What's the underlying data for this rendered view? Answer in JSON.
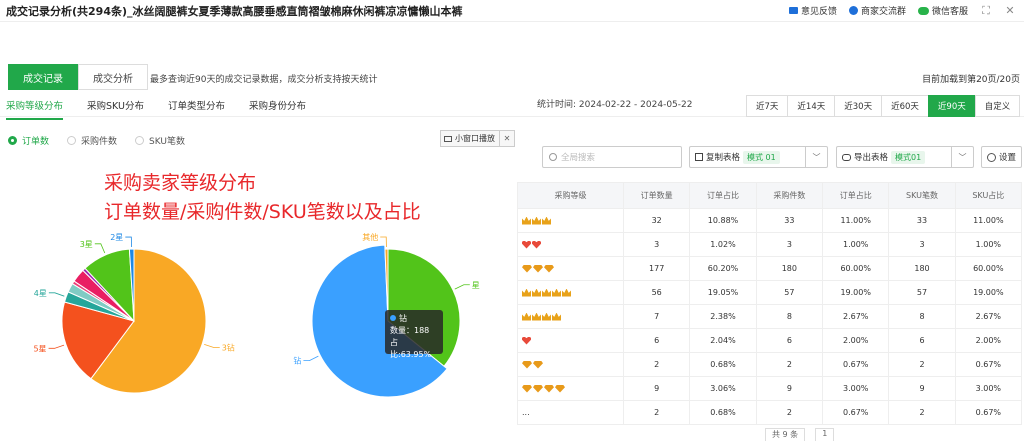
{
  "window": {
    "title": "成交记录分析(共294条)_冰丝阔腿裤女夏季薄款高腰垂感直筒褶皱棉麻休闲裤凉凉慵懒山本裤",
    "feedback": "意见反馈",
    "merchant_group": "商家交流群",
    "wechat_service": "微信客服"
  },
  "main_tabs": [
    {
      "label": "成交记录",
      "active": true
    },
    {
      "label": "成交分析",
      "active": false
    }
  ],
  "main_desc": "最多查询近90天的成交记录数据，成交分析支持按天统计",
  "loaded_text": "目前加载到第20页/20页",
  "sub_tabs": [
    {
      "label": "采购等级分布",
      "active": true
    },
    {
      "label": "采购SKU分布",
      "active": false
    },
    {
      "label": "订单类型分布",
      "active": false
    },
    {
      "label": "采购身份分布",
      "active": false
    }
  ],
  "stat_time": "统计时间: 2024-02-22 - 2024-05-22",
  "ranges": [
    {
      "label": "近7天",
      "active": false
    },
    {
      "label": "近14天",
      "active": false
    },
    {
      "label": "近30天",
      "active": false
    },
    {
      "label": "近60天",
      "active": false
    },
    {
      "label": "近90天",
      "active": true
    },
    {
      "label": "自定义",
      "active": false
    }
  ],
  "radios": [
    {
      "label": "订单数",
      "active": true
    },
    {
      "label": "采购件数",
      "active": false
    },
    {
      "label": "SKU笔数",
      "active": false
    }
  ],
  "mini_window_btn": "小窗口播放",
  "search_placeholder": "全局搜索",
  "copy_table": {
    "label": "复制表格",
    "mode": "模式 01"
  },
  "export_table": {
    "label": "导出表格",
    "mode": "模式01"
  },
  "settings_label": "设置",
  "headline": {
    "line1": "采购卖家等级分布",
    "line2": "订单数量/采购件数/SKU笔数以及占比"
  },
  "chart_data": [
    {
      "type": "pie",
      "slices": [
        {
          "label": "3钻",
          "value": 177,
          "color": "#f9a825"
        },
        {
          "label": "5星",
          "value": 56,
          "color": "#f4511e"
        },
        {
          "label": "4星",
          "value": 7,
          "color": "#26a69a"
        },
        {
          "label": "",
          "value": 6,
          "color": "#80cbc4"
        },
        {
          "label": "",
          "value": 2,
          "color": "#ec407a"
        },
        {
          "label": "",
          "value": 9,
          "color": "#e91e63"
        },
        {
          "label": "",
          "value": 2,
          "color": "#9c27b0"
        },
        {
          "label": "3星",
          "value": 32,
          "color": "#52c41a"
        },
        {
          "label": "2星",
          "value": 3,
          "color": "#1e88e5"
        }
      ]
    },
    {
      "type": "pie",
      "slices": [
        {
          "label": "星",
          "value": 106,
          "color": "#52c41a"
        },
        {
          "label": "钻",
          "value": 188,
          "color": "#3aa0ff"
        },
        {
          "label": "其他",
          "value": 2,
          "color": "#f9a825"
        }
      ]
    }
  ],
  "tooltip": {
    "name": "钻",
    "count_label": "数量：188",
    "ratio_label": "占比:63.95%"
  },
  "table": {
    "headers": [
      "采购等级",
      "订单数量",
      "订单占比",
      "采购件数",
      "订单占比",
      "SKU笔数",
      "SKU占比"
    ],
    "rows": [
      {
        "badge": "crown",
        "badge_count": 3,
        "level_text": "",
        "cells": [
          "32",
          "10.88%",
          "33",
          "11.00%",
          "33",
          "11.00%"
        ]
      },
      {
        "badge": "heart",
        "badge_count": 2,
        "level_text": "",
        "cells": [
          "3",
          "1.02%",
          "3",
          "1.00%",
          "3",
          "1.00%"
        ]
      },
      {
        "badge": "diamond",
        "badge_count": 3,
        "level_text": "",
        "cells": [
          "177",
          "60.20%",
          "180",
          "60.00%",
          "180",
          "60.00%"
        ]
      },
      {
        "badge": "crown",
        "badge_count": 5,
        "level_text": "",
        "cells": [
          "56",
          "19.05%",
          "57",
          "19.00%",
          "57",
          "19.00%"
        ]
      },
      {
        "badge": "crown",
        "badge_count": 4,
        "level_text": "",
        "cells": [
          "7",
          "2.38%",
          "8",
          "2.67%",
          "8",
          "2.67%"
        ]
      },
      {
        "badge": "heart",
        "badge_count": 1,
        "level_text": "",
        "cells": [
          "6",
          "2.04%",
          "6",
          "2.00%",
          "6",
          "2.00%"
        ]
      },
      {
        "badge": "diamond",
        "badge_count": 2,
        "level_text": "",
        "cells": [
          "2",
          "0.68%",
          "2",
          "0.67%",
          "2",
          "0.67%"
        ]
      },
      {
        "badge": "diamond",
        "badge_count": 4,
        "level_text": "",
        "cells": [
          "9",
          "3.06%",
          "9",
          "3.00%",
          "9",
          "3.00%"
        ]
      },
      {
        "badge": "",
        "badge_count": 0,
        "level_text": "...",
        "cells": [
          "2",
          "0.68%",
          "2",
          "0.67%",
          "2",
          "0.67%"
        ]
      }
    ]
  },
  "pager": [
    "共 9 条",
    "1"
  ]
}
